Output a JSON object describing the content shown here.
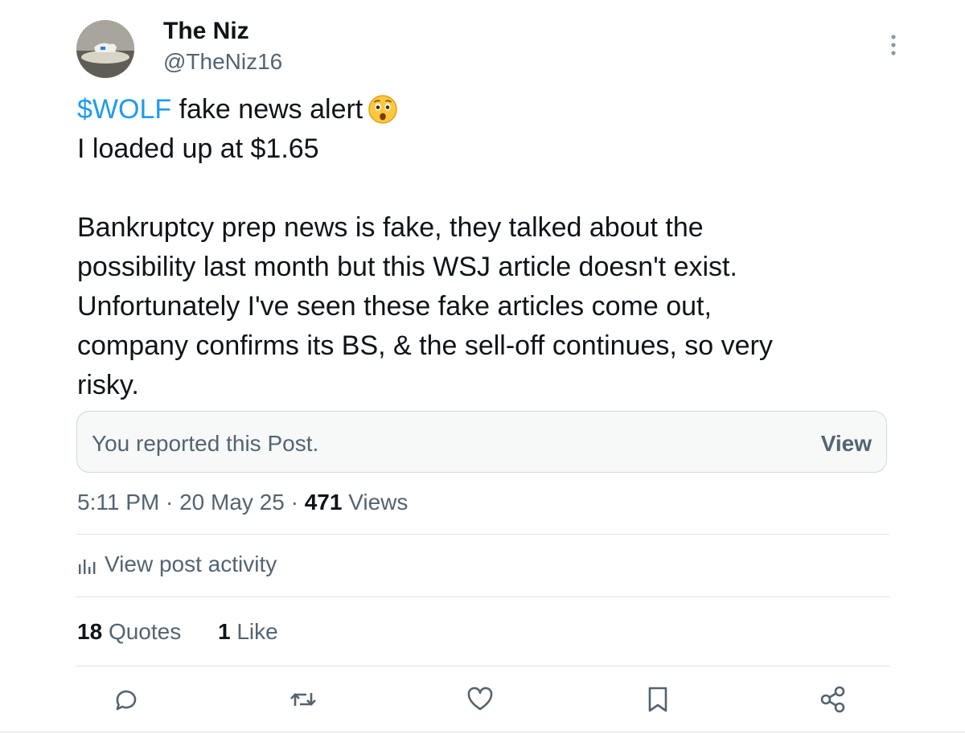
{
  "author": {
    "display_name": "The Niz",
    "handle": "@TheNiz16",
    "avatar_icon": "avatar-photo-dog"
  },
  "tweet": {
    "cashtag": "$WOLF",
    "line1_rest": " fake news alert",
    "emoji_icon": "astonished-face-emoji",
    "line2": "I loaded up at $1.65",
    "para2_lines": [
      "Bankruptcy prep news is fake, they talked about the",
      "possibility last month but this WSJ article doesn't exist.",
      "Unfortunately I've seen these fake articles come out,",
      "company confirms its BS, & the sell-off continues, so very",
      "risky."
    ]
  },
  "report_notice": {
    "text": "You reported this Post.",
    "button_label": "View"
  },
  "meta": {
    "time": "5:11 PM",
    "date": "20 May 25",
    "separator": "·",
    "views_count": "471",
    "views_label": "Views"
  },
  "activity": {
    "label": "View post activity",
    "icon": "bar-chart-icon"
  },
  "stats": {
    "quotes_count": "18",
    "quotes_label": "Quotes",
    "likes_count": "1",
    "likes_label": "Like"
  },
  "actions": [
    "reply-icon",
    "repost-icon",
    "like-icon",
    "bookmark-icon",
    "share-icon"
  ],
  "colors": {
    "accent": "#1d9bf0",
    "text_primary": "#0f1419",
    "text_secondary": "#536471",
    "border": "#cfd9de"
  }
}
